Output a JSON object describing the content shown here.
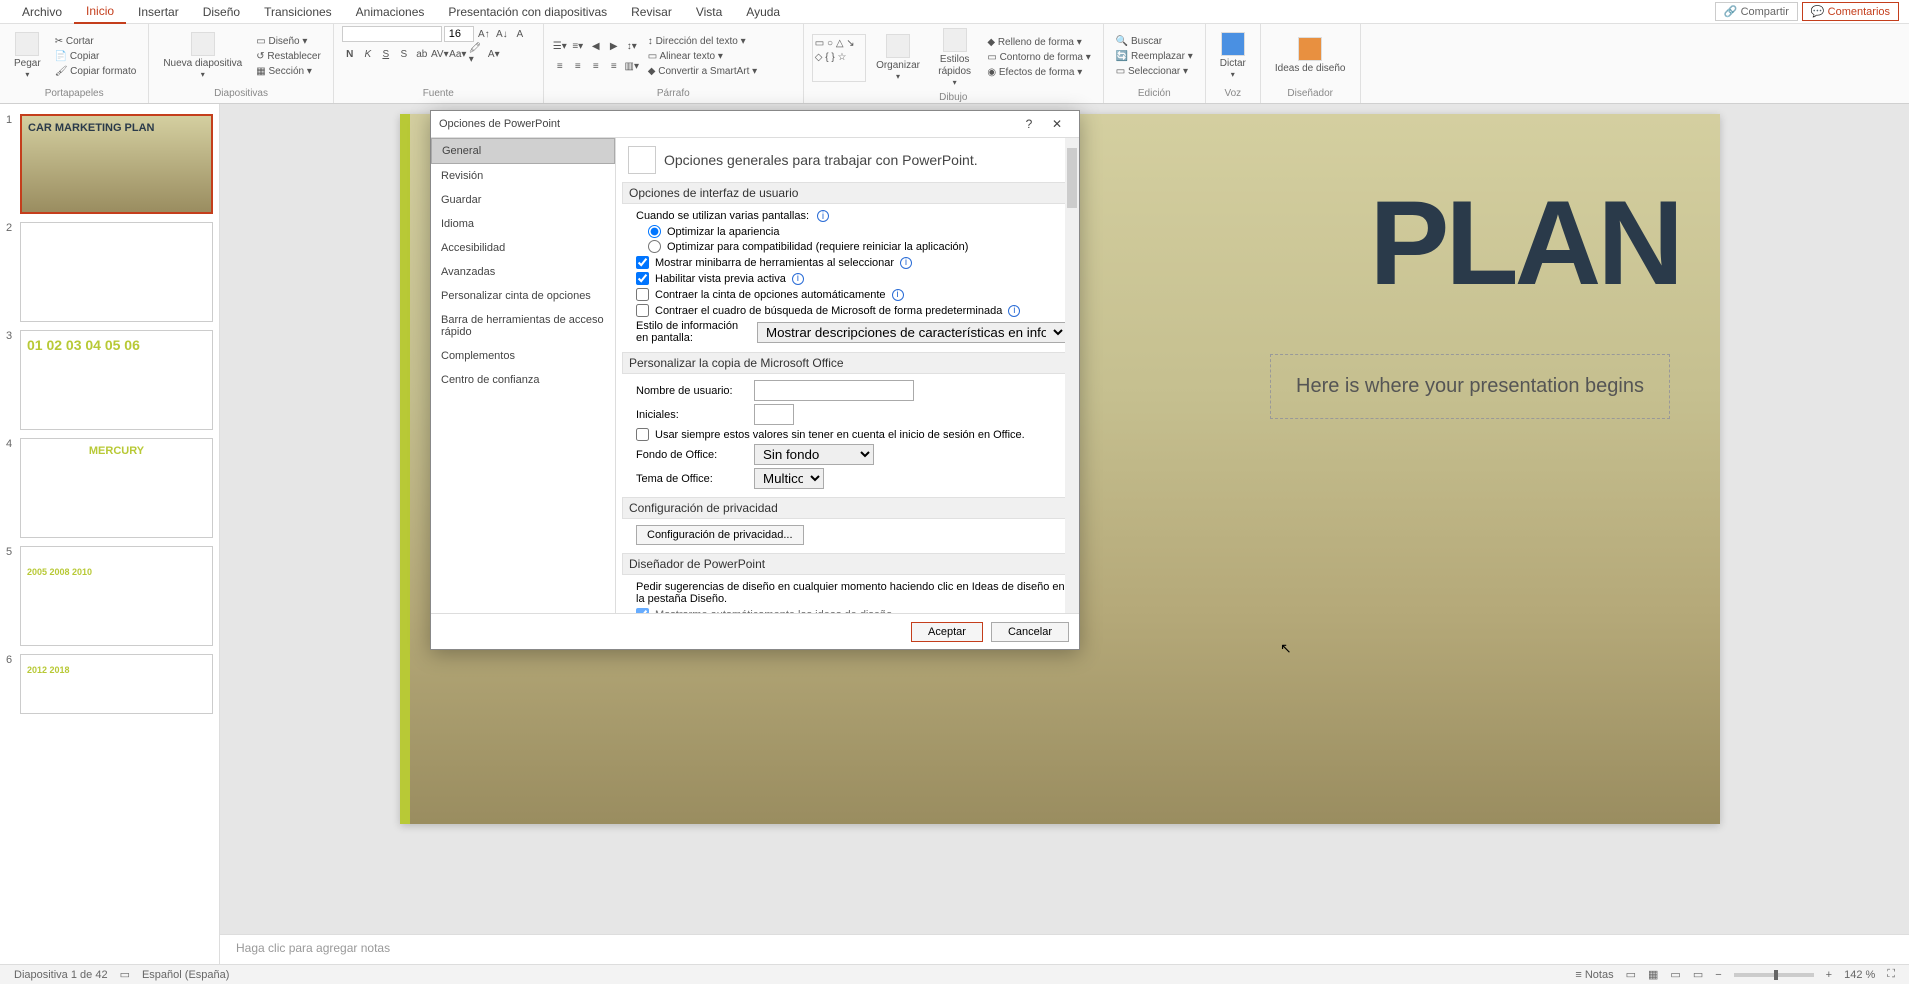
{
  "tabs": {
    "archivo": "Archivo",
    "inicio": "Inicio",
    "insertar": "Insertar",
    "diseno": "Diseño",
    "transiciones": "Transiciones",
    "animaciones": "Animaciones",
    "presentacion": "Presentación con diapositivas",
    "revisar": "Revisar",
    "vista": "Vista",
    "ayuda": "Ayuda"
  },
  "header_buttons": {
    "compartir": "Compartir",
    "comentarios": "Comentarios"
  },
  "ribbon": {
    "portapapeles": {
      "label": "Portapapeles",
      "pegar": "Pegar",
      "cortar": "Cortar",
      "copiar": "Copiar",
      "copiar_formato": "Copiar formato"
    },
    "diapositivas": {
      "label": "Diapositivas",
      "nueva": "Nueva\ndiapositiva",
      "diseno": "Diseño",
      "restablecer": "Restablecer",
      "seccion": "Sección"
    },
    "fuente": {
      "label": "Fuente",
      "font_name": "",
      "font_size": "16"
    },
    "parrafo": {
      "label": "Párrafo",
      "direccion": "Dirección del texto",
      "alinear": "Alinear texto",
      "smartart": "Convertir a SmartArt"
    },
    "dibujo": {
      "label": "Dibujo",
      "organizar": "Organizar",
      "estilos": "Estilos\nrápidos",
      "relleno": "Relleno de forma",
      "contorno": "Contorno de forma",
      "efectos": "Efectos de forma"
    },
    "edicion": {
      "label": "Edición",
      "buscar": "Buscar",
      "reemplazar": "Reemplazar",
      "seleccionar": "Seleccionar"
    },
    "voz": {
      "label": "Voz",
      "dictar": "Dictar"
    },
    "disenador": {
      "label": "Diseñador",
      "ideas": "Ideas de\ndiseño"
    }
  },
  "thumbs": [
    {
      "n": "1",
      "title": "CAR MARKETING PLAN"
    },
    {
      "n": "2",
      "title": ""
    },
    {
      "n": "3",
      "title": "01 02 03\n04 05 06"
    },
    {
      "n": "4",
      "title": "MERCURY"
    },
    {
      "n": "5",
      "title": "2005 2008 2010"
    },
    {
      "n": "6",
      "title": "2012 2018"
    }
  ],
  "slide": {
    "title": "PLAN",
    "subtitle": "Here is where your presentation begins"
  },
  "notes_placeholder": "Haga clic para agregar notas",
  "status": {
    "slide_info": "Diapositiva 1 de 42",
    "language": "Español (España)",
    "notas": "Notas",
    "zoom": "142 %"
  },
  "dialog": {
    "title": "Opciones de PowerPoint",
    "nav": [
      "General",
      "Revisión",
      "Guardar",
      "Idioma",
      "Accesibilidad",
      "Avanzadas",
      "Personalizar cinta de opciones",
      "Barra de herramientas de acceso rápido",
      "Complementos",
      "Centro de confianza"
    ],
    "header_text": "Opciones generales para trabajar con PowerPoint.",
    "sections": {
      "ui": "Opciones de interfaz de usuario",
      "copy": "Personalizar la copia de Microsoft Office",
      "privacy": "Configuración de privacidad",
      "designer": "Diseñador de PowerPoint"
    },
    "ui": {
      "multi_screen": "Cuando se utilizan varias pantallas:",
      "opt_appearance": "Optimizar la apariencia",
      "opt_compat": "Optimizar para compatibilidad (requiere reiniciar la aplicación)",
      "minibar": "Mostrar minibarra de herramientas al seleccionar",
      "live_preview": "Habilitar vista previa activa",
      "collapse_ribbon": "Contraer la cinta de opciones automáticamente",
      "collapse_search": "Contraer el cuadro de búsqueda de Microsoft de forma predeterminada",
      "tooltip_label": "Estilo de información en pantalla:",
      "tooltip_value": "Mostrar descripciones de características en información en pantalla"
    },
    "copy": {
      "username_label": "Nombre de usuario:",
      "initials_label": "Iniciales:",
      "always_use": "Usar siempre estos valores sin tener en cuenta el inicio de sesión en Office.",
      "background_label": "Fondo de Office:",
      "background_value": "Sin fondo",
      "theme_label": "Tema de Office:",
      "theme_value": "Multicolor"
    },
    "privacy": {
      "button": "Configuración de privacidad..."
    },
    "designer": {
      "text": "Pedir sugerencias de diseño en cualquier momento haciendo clic en Ideas de diseño en la pestaña Diseño.",
      "auto_show": "Mostrarme automáticamente las ideas de diseño"
    },
    "buttons": {
      "ok": "Aceptar",
      "cancel": "Cancelar"
    }
  }
}
